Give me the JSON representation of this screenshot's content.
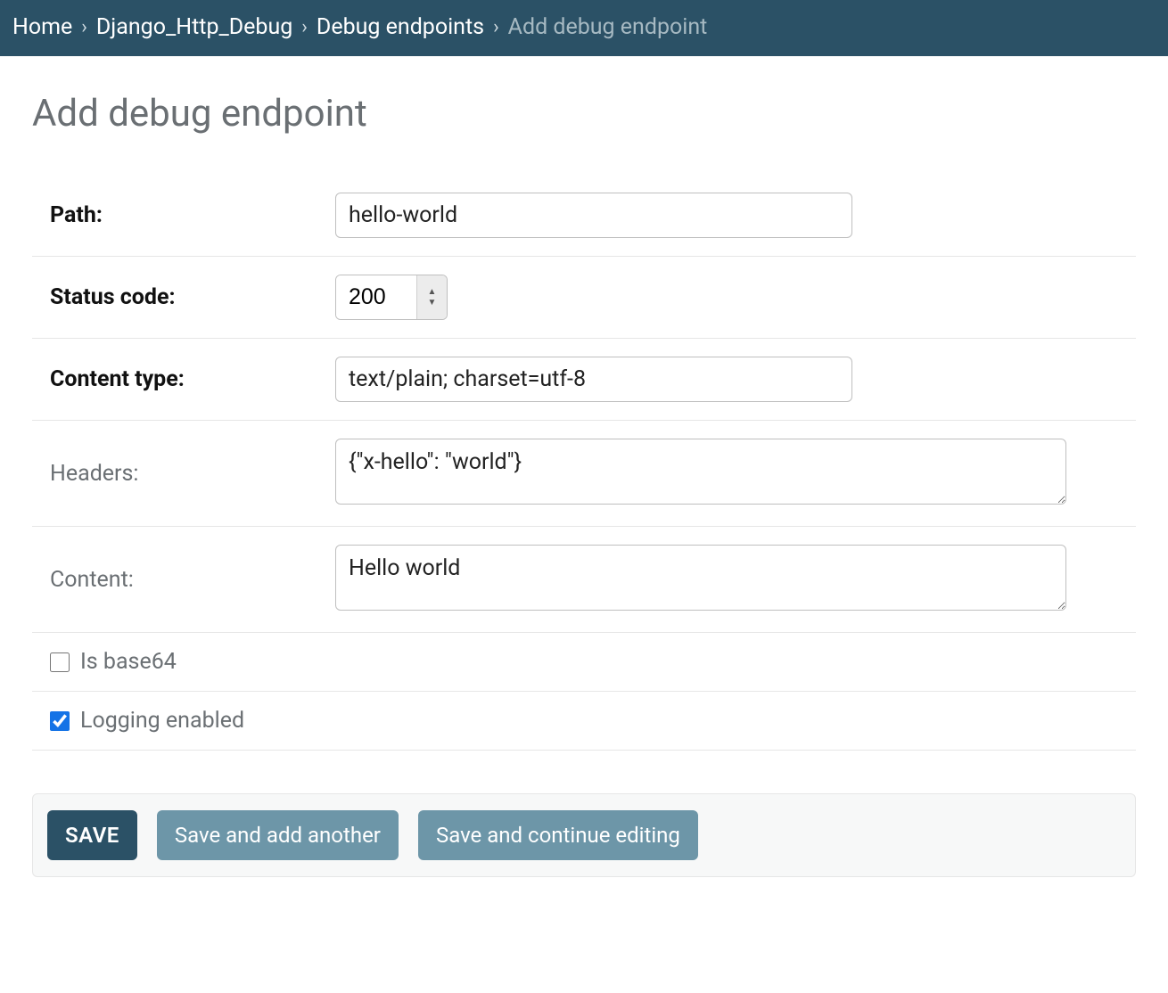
{
  "breadcrumbs": {
    "home": "Home",
    "app": "Django_Http_Debug",
    "model": "Debug endpoints",
    "current": "Add debug endpoint",
    "sep": "›"
  },
  "title": "Add debug endpoint",
  "fields": {
    "path": {
      "label": "Path:",
      "value": "hello-world"
    },
    "status_code": {
      "label": "Status code:",
      "value": "200"
    },
    "content_type": {
      "label": "Content type:",
      "value": "text/plain; charset=utf-8"
    },
    "headers": {
      "label": "Headers:",
      "value": "{\"x-hello\": \"world\"}"
    },
    "content": {
      "label": "Content:",
      "value": "Hello world"
    },
    "is_base64": {
      "label": "Is base64",
      "checked": false
    },
    "logging": {
      "label": "Logging enabled",
      "checked": true
    }
  },
  "buttons": {
    "save": "SAVE",
    "save_add": "Save and add another",
    "save_continue": "Save and continue editing"
  }
}
